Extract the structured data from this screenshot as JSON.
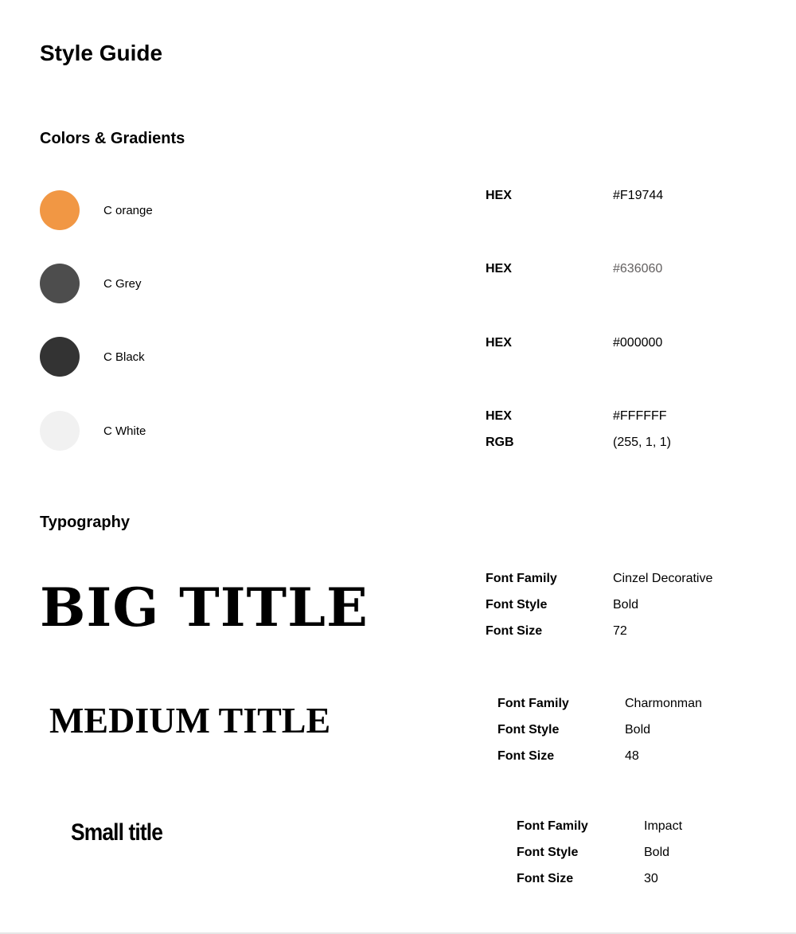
{
  "page": {
    "title": "Style Guide"
  },
  "colors_section": {
    "title": "Colors & Gradients",
    "items": [
      {
        "name": "C orange",
        "swatch": "#F19744",
        "hex_label": "HEX",
        "hex_value": "#F19744",
        "value_color": "#000000"
      },
      {
        "name": "C Grey",
        "swatch": "#4D4D4D",
        "hex_label": "HEX",
        "hex_value": "#636060",
        "value_color": "#636060"
      },
      {
        "name": "C Black",
        "swatch": "#333333",
        "hex_label": "HEX",
        "hex_value": "#000000",
        "value_color": "#000000"
      },
      {
        "name": "C White",
        "swatch": "#F1F1F1",
        "hex_label": "HEX",
        "hex_value": "#FFFFFF",
        "value_color": "#000000",
        "rgb_label": "RGB",
        "rgb_value": "(255, 1, 1)"
      }
    ]
  },
  "typography_section": {
    "title": "Typography",
    "styles": [
      {
        "sample": "BIG TITLE",
        "family_label": "Font Family",
        "family_value": "Cinzel Decorative",
        "style_label": "Font Style",
        "style_value": "Bold",
        "size_label": "Font Size",
        "size_value": "72"
      },
      {
        "sample": "MEDIUM TITLE",
        "family_label": "Font Family",
        "family_value": "Charmonman",
        "style_label": "Font Style",
        "style_value": "Bold",
        "size_label": "Font Size",
        "size_value": "48"
      },
      {
        "sample": "Small title",
        "family_label": "Font Family",
        "family_value": "Impact",
        "style_label": "Font Style",
        "style_value": "Bold",
        "size_label": "Font Size",
        "size_value": "30"
      }
    ]
  }
}
